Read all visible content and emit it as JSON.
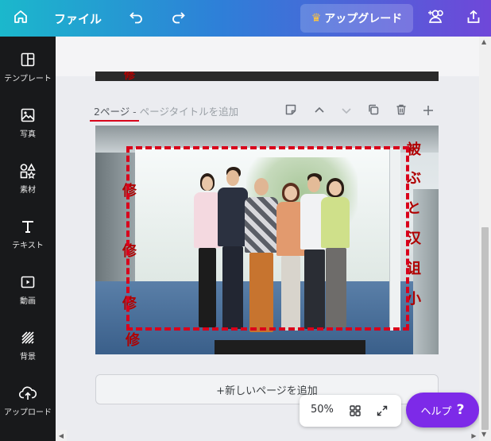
{
  "topbar": {
    "home_icon": "home-icon",
    "file_label": "ファイル",
    "undo_icon": "undo-icon",
    "redo_icon": "redo-icon",
    "upgrade_label": "アップグレード",
    "crown_icon": "crown-icon",
    "share_icon": "add-people-icon",
    "export_icon": "upload-share-icon",
    "accent_color": "#ffc53d"
  },
  "sidebar": {
    "items": [
      {
        "label": "テンプレート",
        "icon": "template-icon"
      },
      {
        "label": "写真",
        "icon": "photo-icon"
      },
      {
        "label": "素材",
        "icon": "elements-icon"
      },
      {
        "label": "テキスト",
        "icon": "text-icon"
      },
      {
        "label": "動画",
        "icon": "video-icon"
      },
      {
        "label": "背景",
        "icon": "background-icon"
      },
      {
        "label": "アップロード",
        "icon": "upload-icon"
      }
    ]
  },
  "page": {
    "number_label": "2ページ",
    "separator": " - ",
    "title_placeholder": "ページタイトルを追加",
    "annotation_color": "#d9001b"
  },
  "page_tools": [
    "note-icon",
    "chevron-up-icon",
    "chevron-down-icon",
    "duplicate-icon",
    "trash-icon",
    "plus-icon"
  ],
  "page2": {
    "chars_right": [
      "被",
      "ぶ",
      "と",
      "汉",
      "诅",
      "小"
    ],
    "chars_left": [
      "修",
      "修",
      "修",
      "修"
    ]
  },
  "prev_page": {
    "char": "修"
  },
  "add_page_label": "+新しいページを追加",
  "zoom": {
    "percent": "50%",
    "grid_icon": "grid-view-icon",
    "fullscreen_icon": "fullscreen-icon"
  },
  "help": {
    "label": "ヘルプ",
    "mark": "?",
    "color": "#7d2ae8"
  }
}
